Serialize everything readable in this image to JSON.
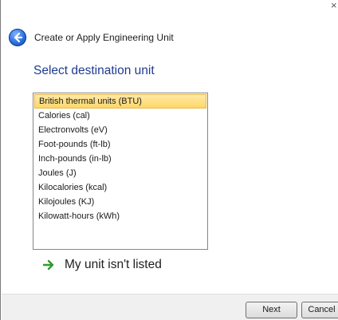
{
  "window": {
    "title": "Create or Apply Engineering Unit",
    "close_glyph": "×"
  },
  "icons": {
    "back": "back-arrow-circle-icon",
    "link_arrow": "green-right-arrow-icon"
  },
  "colors": {
    "heading": "#1f3b8f",
    "selection_fill": "#ffd767",
    "link_arrow": "#2e9d2e"
  },
  "heading": "Select destination unit",
  "units": {
    "items": [
      "British thermal units (BTU)",
      "Calories (cal)",
      "Electronvolts (eV)",
      "Foot-pounds (ft-lb)",
      "Inch-pounds (in-lb)",
      "Joules (J)",
      "Kilocalories (kcal)",
      "Kilojoules (KJ)",
      "Kilowatt-hours (kWh)"
    ],
    "selected_index": 0
  },
  "link": {
    "label": "My unit isn't listed"
  },
  "buttons": {
    "next": "Next",
    "cancel": "Cancel"
  }
}
